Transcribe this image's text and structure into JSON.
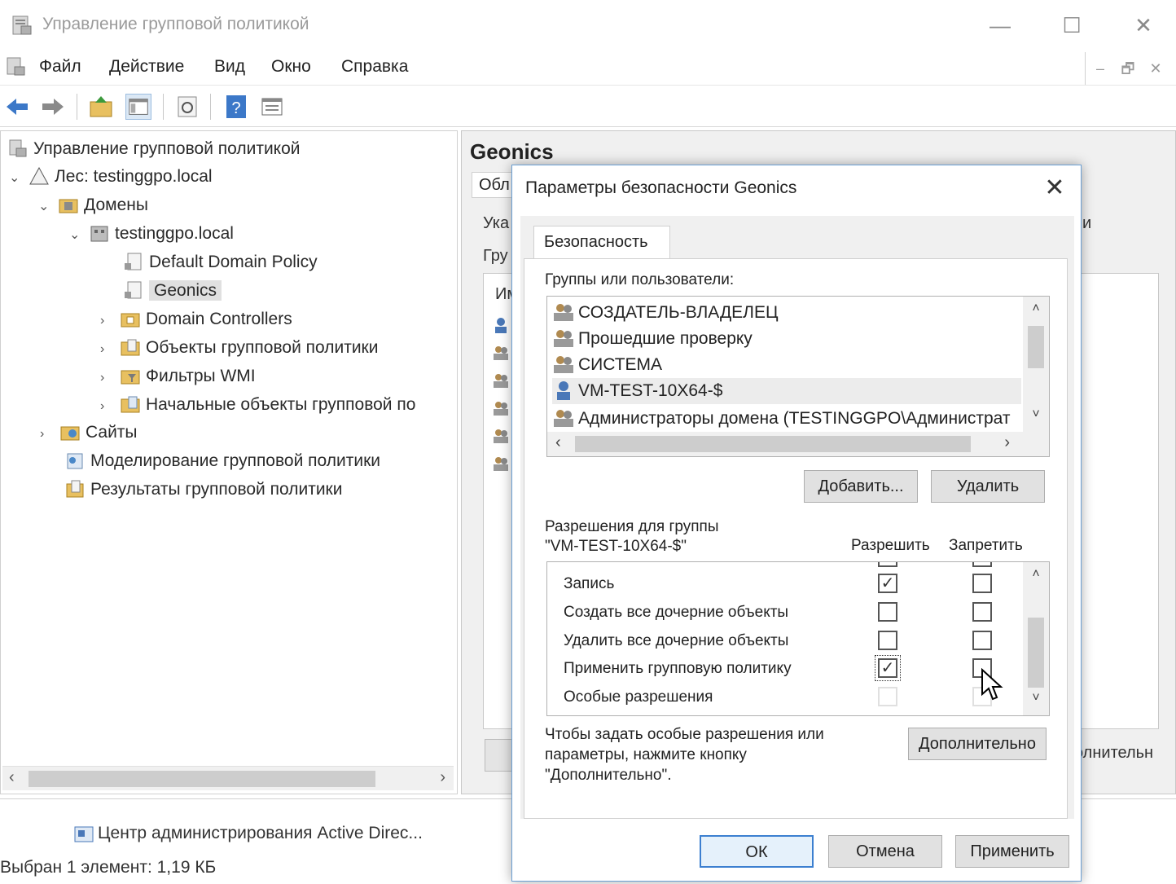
{
  "window": {
    "title": "Управление групповой политикой",
    "controls": {
      "minimize": "—",
      "maximize": "☐",
      "close": "✕"
    }
  },
  "menubar": {
    "items": [
      "Файл",
      "Действие",
      "Вид",
      "Окно",
      "Справка"
    ],
    "mdi": {
      "minimize": "–",
      "restore": "🗗",
      "close": "✕"
    }
  },
  "tree": {
    "items": [
      {
        "label": "Управление групповой политикой",
        "icon": "gpmc-root-icon",
        "chevron": ""
      },
      {
        "label": "Лес: testinggpo.local",
        "icon": "forest-icon",
        "chevron": "⌄"
      },
      {
        "label": "Домены",
        "icon": "domains-folder-icon",
        "chevron": "⌄"
      },
      {
        "label": "testinggpo.local",
        "icon": "domain-icon",
        "chevron": "⌄"
      },
      {
        "label": "Default Domain Policy",
        "icon": "gpo-link-icon",
        "chevron": ""
      },
      {
        "label": "Geonics",
        "icon": "gpo-link-icon",
        "chevron": ""
      },
      {
        "label": "Domain Controllers",
        "icon": "ou-folder-icon",
        "chevron": "›"
      },
      {
        "label": "Объекты групповой политики",
        "icon": "gpo-folder-icon",
        "chevron": "›"
      },
      {
        "label": "Фильтры WMI",
        "icon": "wmi-folder-icon",
        "chevron": "›"
      },
      {
        "label": "Начальные объекты групповой по",
        "icon": "starter-gpo-folder-icon",
        "chevron": "›"
      },
      {
        "label": "Сайты",
        "icon": "sites-folder-icon",
        "chevron": "›"
      },
      {
        "label": "Моделирование групповой политики",
        "icon": "modeling-icon",
        "chevron": ""
      },
      {
        "label": "Результаты групповой политики",
        "icon": "results-icon",
        "chevron": ""
      }
    ],
    "scroll_left": "‹",
    "scroll_right": "›"
  },
  "right_pane": {
    "title": "Geonics",
    "tab_partial": "Обл",
    "text_1": "Ука",
    "text_2": "Гру",
    "text_3": "Им",
    "text_right": "и",
    "button_partial": "олнительн"
  },
  "status": {
    "taskbar_partial": "Центр администрирования Active Direc...",
    "selection": "Выбран 1 элемент: 1,19 КБ"
  },
  "dialog": {
    "title": "Параметры безопасности Geonics",
    "close": "✕",
    "tab": "Безопасность",
    "groups_label": "Группы или пользователи:",
    "users": [
      {
        "name": "СОЗДАТЕЛЬ-ВЛАДЕЛЕЦ",
        "icon": "group-icon",
        "selected": false
      },
      {
        "name": "Прошедшие проверку",
        "icon": "group-icon",
        "selected": false
      },
      {
        "name": "СИСТЕМА",
        "icon": "group-icon",
        "selected": false
      },
      {
        "name": "VM-TEST-10X64-$",
        "icon": "user-icon",
        "selected": true
      },
      {
        "name": "Администраторы домена (TESTINGGPO\\Администрат",
        "icon": "group-icon",
        "selected": false
      }
    ],
    "add_button": "Добавить...",
    "remove_button": "Удалить",
    "permissions_label_line1": "Разрешения для группы",
    "permissions_label_line2": "\"VM-TEST-10X64-$\"",
    "allow_col": "Разрешить",
    "deny_col": "Запретить",
    "permissions": [
      {
        "name": "Запись",
        "allow": true,
        "deny": false,
        "enabled": true
      },
      {
        "name": "Создать все дочерние объекты",
        "allow": false,
        "deny": false,
        "enabled": true
      },
      {
        "name": "Удалить все дочерние объекты",
        "allow": false,
        "deny": false,
        "enabled": true
      },
      {
        "name": "Применить групповую политику",
        "allow": true,
        "deny": false,
        "enabled": true
      },
      {
        "name": "Особые разрешения",
        "allow": false,
        "deny": false,
        "enabled": false
      }
    ],
    "help_text": "Чтобы задать особые разрешения или параметры, нажмите кнопку \"Дополнительно\".",
    "advanced_button": "Дополнительно",
    "ok_button": "ОК",
    "cancel_button": "Отмена",
    "apply_button": "Применить",
    "check_mark": "✓",
    "scroll_up": "˄",
    "scroll_down": "˅",
    "scroll_left": "‹",
    "scroll_right": "›"
  },
  "colors": {
    "accent": "#3c7fd0",
    "dialog_border": "#6a9fd4",
    "selection_bg": "#e0e0e0"
  }
}
